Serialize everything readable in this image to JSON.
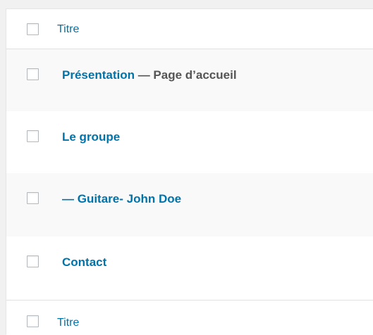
{
  "table": {
    "header": {
      "column_title": "Titre"
    },
    "footer": {
      "column_title": "Titre"
    },
    "rows": [
      {
        "title": "Présentation",
        "state": " — Page d’accueil"
      },
      {
        "title": "Le groupe",
        "state": ""
      },
      {
        "title": "— Guitare- John Doe",
        "state": ""
      },
      {
        "title": "Contact",
        "state": ""
      }
    ]
  },
  "colors": {
    "link": "#0073aa",
    "state_text": "#555555",
    "alt_row": "#f9f9f9",
    "background": "#f1f1f1"
  }
}
